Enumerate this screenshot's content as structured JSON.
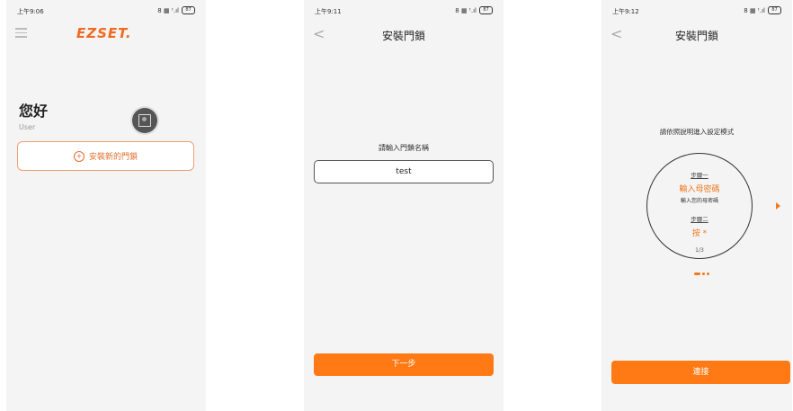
{
  "status_bars": [
    {
      "time": "上午9:06",
      "icons": "8 ▦ ᵗ.ıl",
      "battery": "87"
    },
    {
      "time": "上午9:11",
      "icons": "8 ▦ ᵗ.ıl",
      "battery": "87"
    },
    {
      "time": "上午9:12",
      "icons": "8 ▦ ᵗ.ıl",
      "battery": "87"
    }
  ],
  "screen1": {
    "logo": "EZSET.",
    "greeting": "您好",
    "username": "User",
    "add_lock_label": "安裝新的門鎖",
    "add_lock_icon": "plus-icon"
  },
  "screen2": {
    "title": "安裝門鎖",
    "prompt": "請輸入門鎖名稱",
    "input_value": "test",
    "next_label": "下一步"
  },
  "screen3": {
    "title": "安裝門鎖",
    "instruction": "請依照說明進入設定模式",
    "step1_label": "步驟一",
    "step1_action": "輸入母密碼",
    "step1_desc": "輸入您的母密碼",
    "step2_label": "步驟二",
    "step2_action": "按 *",
    "page_indicator": "1/3",
    "connect_label": "連接"
  },
  "colors": {
    "accent": "#ff7a14",
    "background": "#f4f4f4"
  }
}
